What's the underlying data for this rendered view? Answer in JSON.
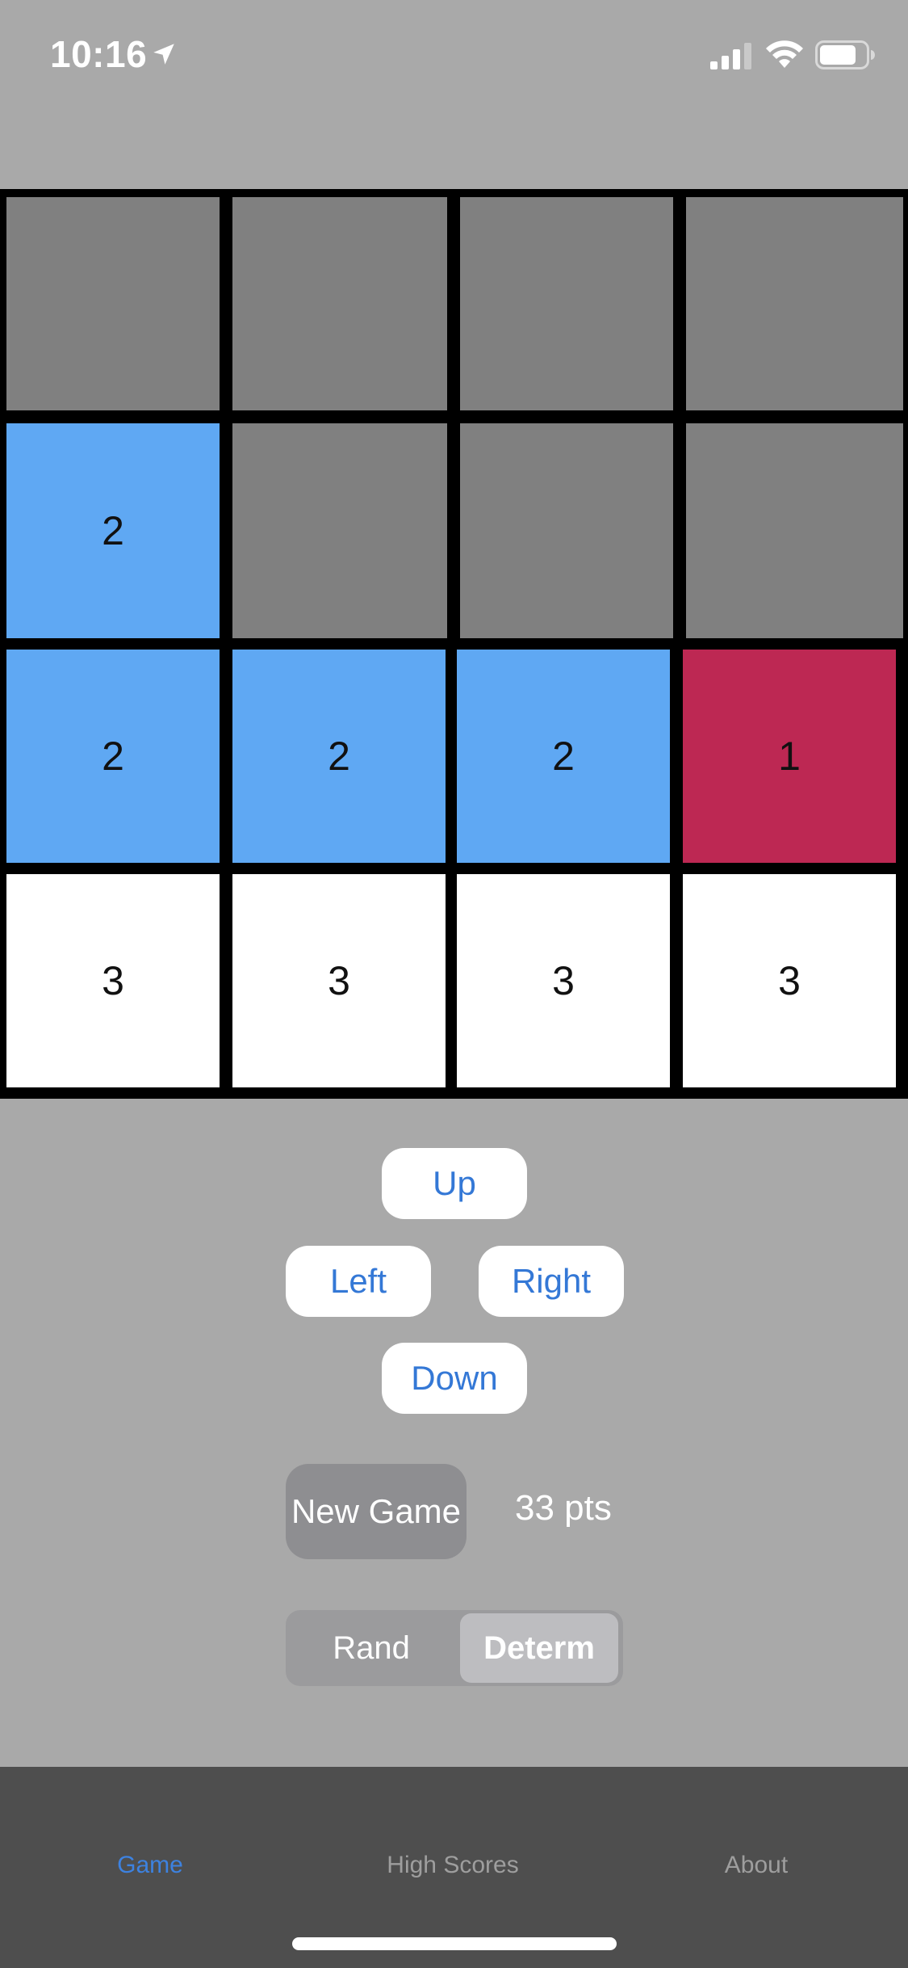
{
  "status_bar": {
    "time": "10:16",
    "icons": [
      "location-arrow-icon",
      "signal-icon",
      "wifi-icon",
      "battery-icon"
    ]
  },
  "board": {
    "rows": 4,
    "cols": 4,
    "cells": [
      [
        "",
        "",
        "",
        ""
      ],
      [
        "2",
        "",
        "",
        ""
      ],
      [
        "2",
        "2",
        "2",
        "1"
      ],
      [
        "3",
        "3",
        "3",
        "3"
      ]
    ],
    "colors": {
      "empty": "#808080",
      "two": "#5fa8f3",
      "one": "#bd2853",
      "three": "#ffffff",
      "grid": "#000000"
    }
  },
  "controls": {
    "up": "Up",
    "left": "Left",
    "right": "Right",
    "down": "Down",
    "new_game": "New Game",
    "score": "33 pts"
  },
  "mode": {
    "options": [
      "Rand",
      "Determ"
    ],
    "selected": "Determ"
  },
  "tabs": {
    "game": "Game",
    "high_scores": "High Scores",
    "about": "About",
    "active": "Game",
    "accent": "#3d82e0"
  }
}
